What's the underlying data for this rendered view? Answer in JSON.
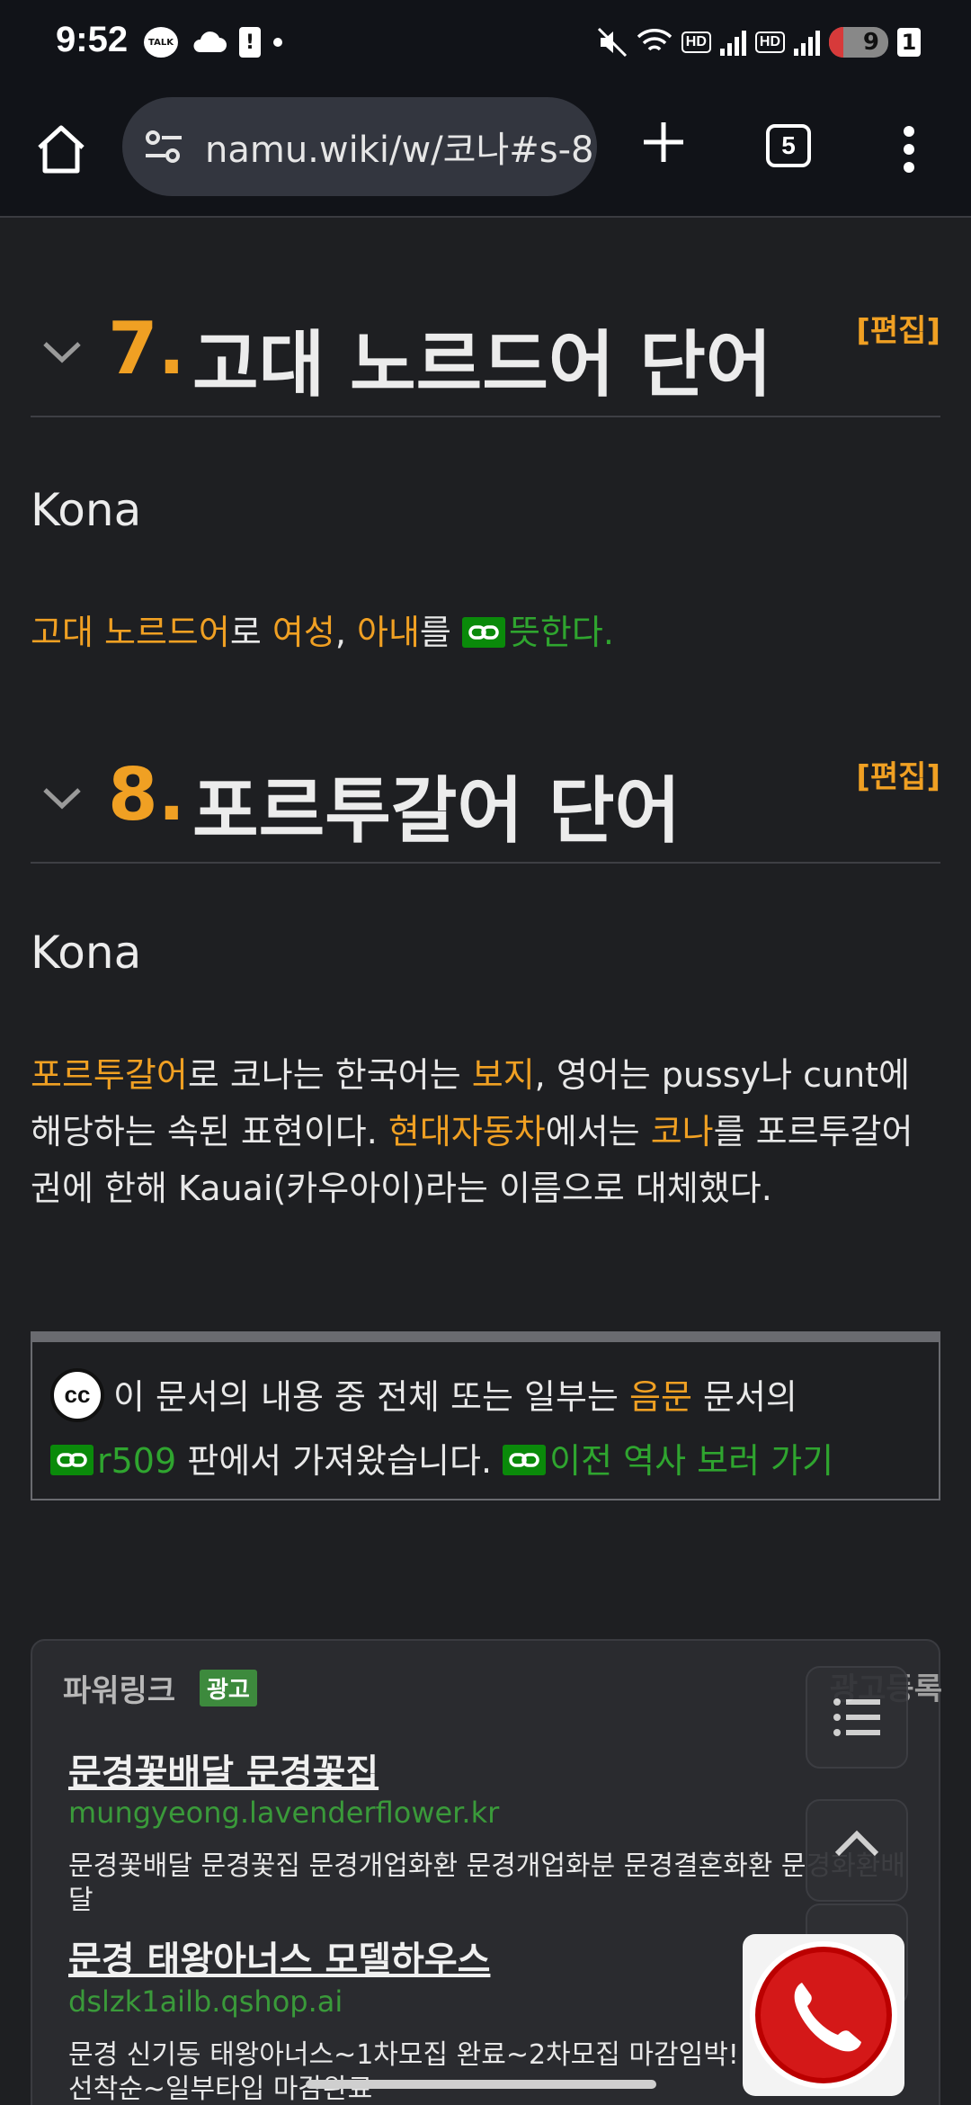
{
  "status_bar": {
    "time": "9:52",
    "talk_label": "TALK",
    "hd1": "HD",
    "hd2": "HD",
    "battery": "9",
    "badge": "1"
  },
  "browser": {
    "url": "namu.wiki/w/코나#s-8",
    "tab_count": "5"
  },
  "sections": [
    {
      "number": "7.",
      "title": "고대 노르드어 단어",
      "edit": "[편집]",
      "word": "Kona",
      "para": {
        "p1": "고대 노르드어",
        "p2": "로 ",
        "p3": "여성",
        "p4": ", ",
        "p5": "아내",
        "p6": "를 ",
        "p7": "뜻한다."
      }
    },
    {
      "number": "8.",
      "title": "포르투갈어 단어",
      "edit": "[편집]",
      "word": "Kona",
      "para": {
        "p1": "포르투갈어",
        "p2": "로 코나는 한국어는 ",
        "p3": "보지",
        "p4": ", 영어는 pussy나 cunt에 해당하는 속된 표현이다. ",
        "p5": "현대자동차",
        "p6": "에서는 ",
        "p7": "코나",
        "p8": "를 포르투갈어권에 한해 Kauai(카우아이)라는 이름으로 대체했다."
      }
    }
  ],
  "license": {
    "cc": "cc",
    "t1": "이 문서의 내용 중 전체 또는 일부는 ",
    "doc": "음문",
    "t2": " 문서의",
    "rev": "r509",
    "t3": " 판에서 가져왔습니다. ",
    "history": "이전 역사 보러 가기"
  },
  "ad": {
    "label": "파워링크",
    "badge": "광고",
    "register": "광고등록",
    "items": [
      {
        "title": "문경꽃배달 문경꽃집",
        "domain": "mungyeong.lavenderflower.kr",
        "desc": "문경꽃배달 문경꽃집 문경개업화환 문경개업화분 문경결혼화환 문경화환배달"
      },
      {
        "title": "문경 태왕아너스 모델하우스",
        "domain": "dslzk1ailb.qshop.ai",
        "desc": "문경 신기동 태왕아너스~1차모집 완료~2차모집 마감임박! 선착순~일부타입 마감완료"
      }
    ]
  },
  "colors": {
    "accent_orange": "#f0a023",
    "link_green": "#2fa52f",
    "background": "#1e1f22"
  }
}
